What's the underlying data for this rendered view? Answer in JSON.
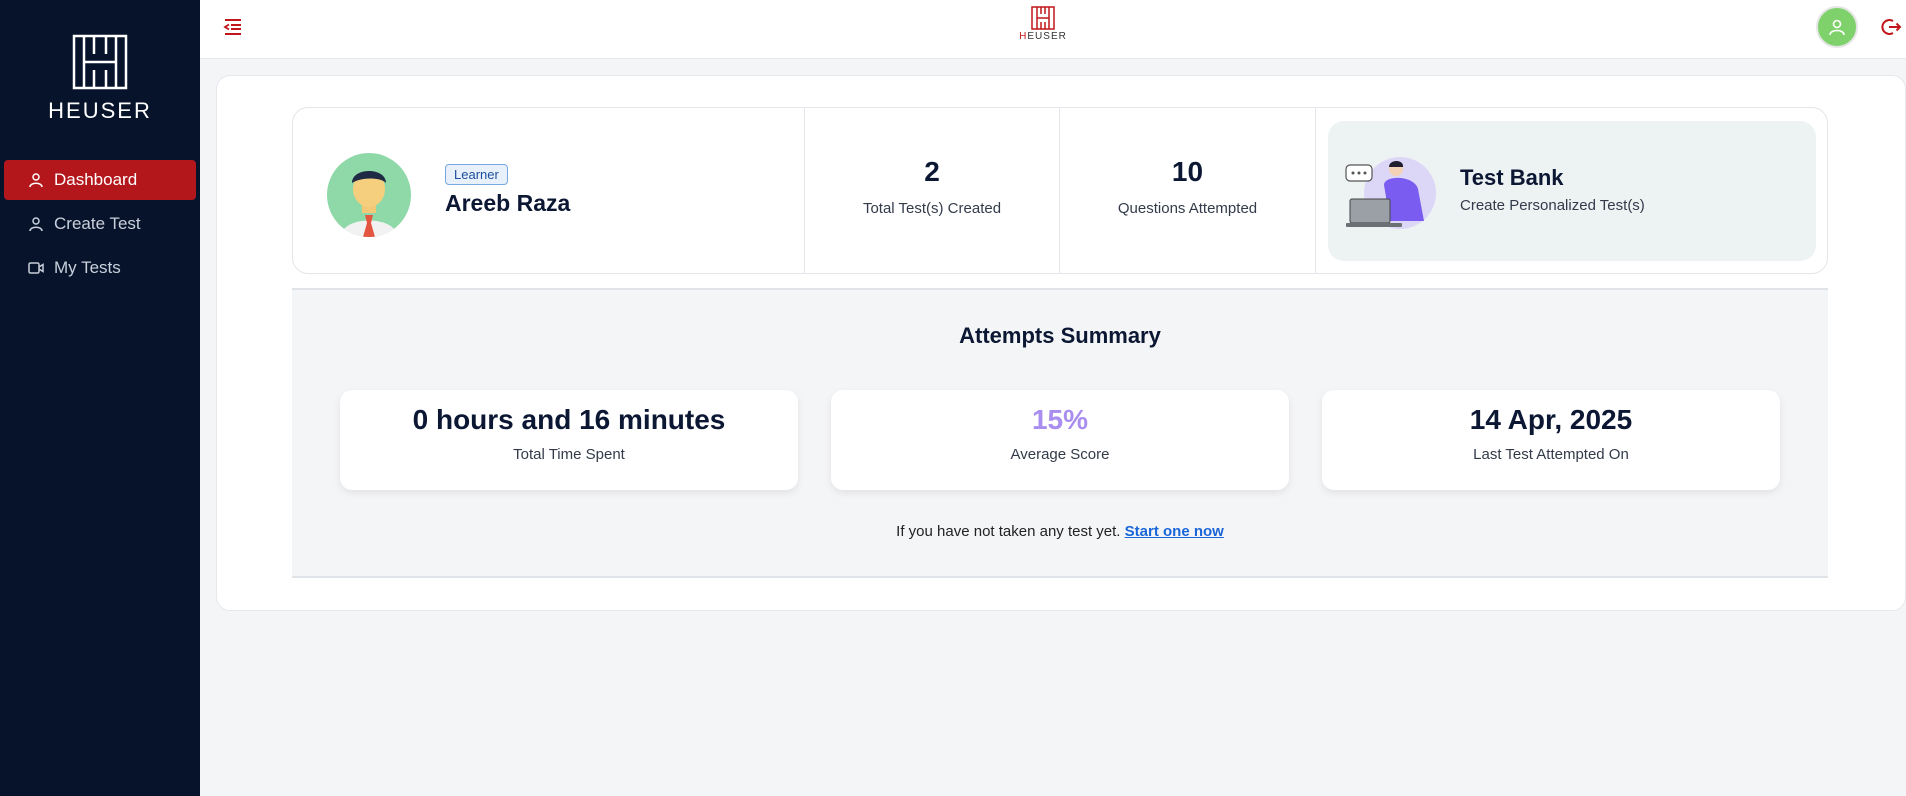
{
  "brand": {
    "name": "HEUSER",
    "header_logo_prefix": "H",
    "header_logo_rest": "EUSER"
  },
  "sidebar": {
    "items": [
      {
        "label": "Dashboard",
        "icon": "user-icon",
        "active": true
      },
      {
        "label": "Create Test",
        "icon": "user-icon",
        "active": false
      },
      {
        "label": "My Tests",
        "icon": "video-icon",
        "active": false
      }
    ]
  },
  "header": {
    "menu_icon": "menu-collapse-icon",
    "avatar_icon": "user-icon",
    "logout_icon": "logout-icon"
  },
  "profile": {
    "role": "Learner",
    "name": "Areeb Raza"
  },
  "stats": [
    {
      "value": "2",
      "label": "Total Test(s) Created"
    },
    {
      "value": "10",
      "label": "Questions Attempted"
    }
  ],
  "test_bank": {
    "title": "Test Bank",
    "subtitle": "Create Personalized Test(s)"
  },
  "attempts": {
    "title": "Attempts Summary",
    "cards": [
      {
        "value": "0 hours and 16 minutes",
        "label": "Total Time Spent"
      },
      {
        "value": "15%",
        "label": "Average Score"
      },
      {
        "value": "14 Apr, 2025",
        "label": "Last Test Attempted On"
      }
    ],
    "hint_text": "If you have not taken any test yet.",
    "hint_link": "Start one now"
  },
  "colors": {
    "sidebar_bg": "#06132b",
    "active": "#b3161b",
    "score_accent": "#a98ef0",
    "link": "#1a66d9",
    "avatar_bg": "#7fd26b"
  }
}
